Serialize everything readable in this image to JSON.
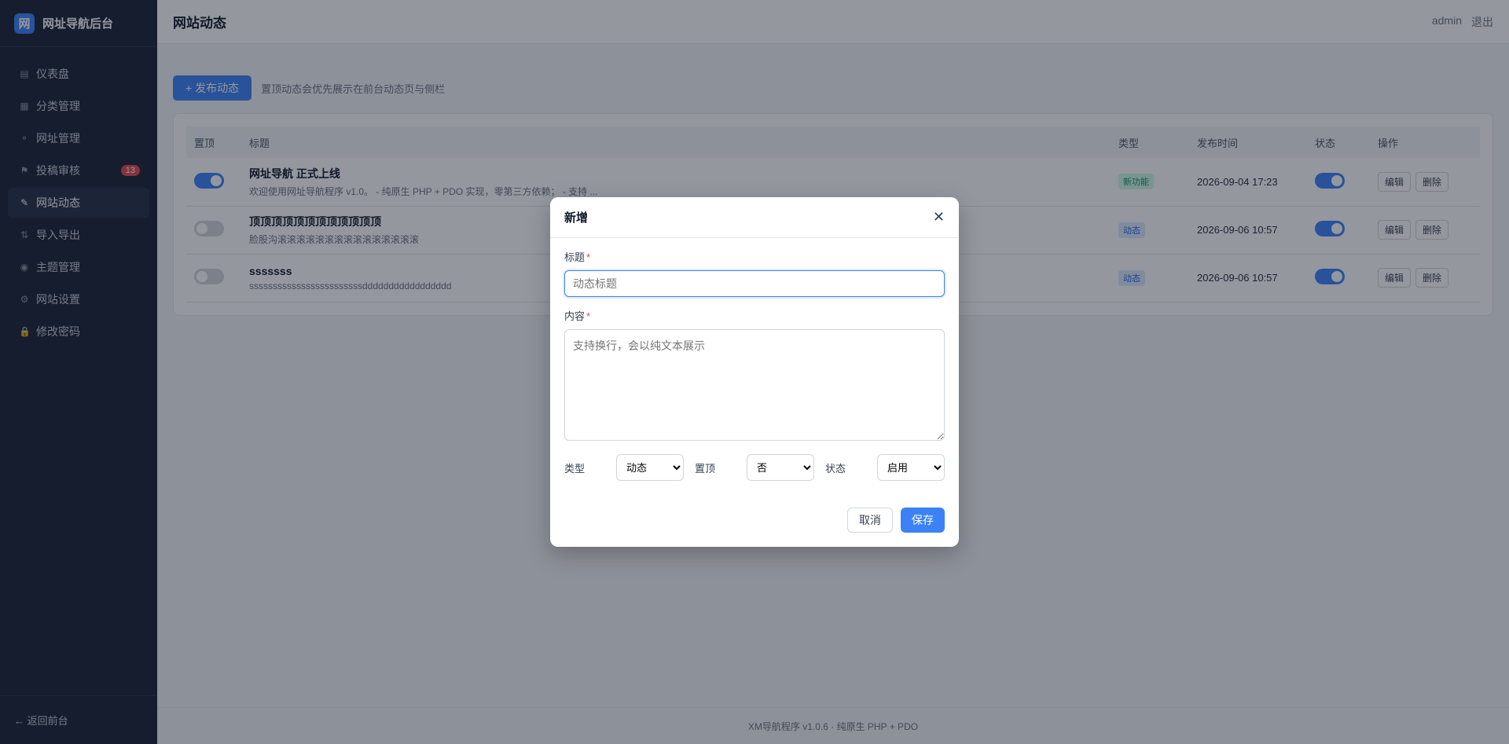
{
  "brand": {
    "logo": "网",
    "title": "网址导航后台"
  },
  "sidebar": {
    "items": [
      {
        "label": "仪表盘",
        "icon": "▤"
      },
      {
        "label": "分类管理",
        "icon": "▦"
      },
      {
        "label": "网址管理",
        "icon": "⚬"
      },
      {
        "label": "投稿审核",
        "icon": "⚑",
        "badge": "13"
      },
      {
        "label": "网站动态",
        "icon": "✎"
      },
      {
        "label": "导入导出",
        "icon": "⇅"
      },
      {
        "label": "主题管理",
        "icon": "◉"
      },
      {
        "label": "网站设置",
        "icon": "⚙"
      },
      {
        "label": "修改密码",
        "icon": "🔒"
      }
    ],
    "back": "← 返回前台"
  },
  "header": {
    "title": "网站动态",
    "user": "admin",
    "logout": "退出"
  },
  "toolbar": {
    "publish": "+ 发布动态",
    "hint": "置顶动态会优先展示在前台动态页与侧栏"
  },
  "table": {
    "headers": [
      "置顶",
      "标题",
      "类型",
      "发布时间",
      "状态",
      "操作"
    ],
    "rows": [
      {
        "pinned": true,
        "title": "网址导航 正式上线",
        "summary": "欢迎使用网址导航程序 v1.0。 - 纯原生 PHP + PDO 实现，零第三方依赖； - 支持 ...",
        "type": "新功能",
        "time": "2026-09-04 17:23",
        "status": true,
        "edit": "编辑",
        "delete": "删除"
      },
      {
        "pinned": false,
        "title": "顶顶顶顶顶顶顶顶顶顶顶顶",
        "summary": "脸股沟滚滚滚滚滚滚滚滚滚滚滚滚滚滚滚",
        "type": "动态",
        "time": "2026-09-06 10:57",
        "status": true,
        "edit": "编辑",
        "delete": "删除"
      },
      {
        "pinned": false,
        "title": "sssssss",
        "summary": "ssssssssssssssssssssssssddddddddddddddddd",
        "type": "动态",
        "time": "2026-09-06 10:57",
        "status": true,
        "edit": "编辑",
        "delete": "删除"
      }
    ]
  },
  "footer": "XM导航程序 v1.0.6 · 纯原生 PHP + PDO",
  "modal": {
    "title": "新增",
    "title_label": "标题",
    "title_placeholder": "动态标题",
    "content_label": "内容",
    "content_placeholder": "支持换行，会以纯文本展示",
    "type_label": "类型",
    "type_value": "动态",
    "pin_label": "置顶",
    "pin_value": "否",
    "status_label": "状态",
    "status_value": "启用",
    "cancel": "取消",
    "save": "保存"
  }
}
